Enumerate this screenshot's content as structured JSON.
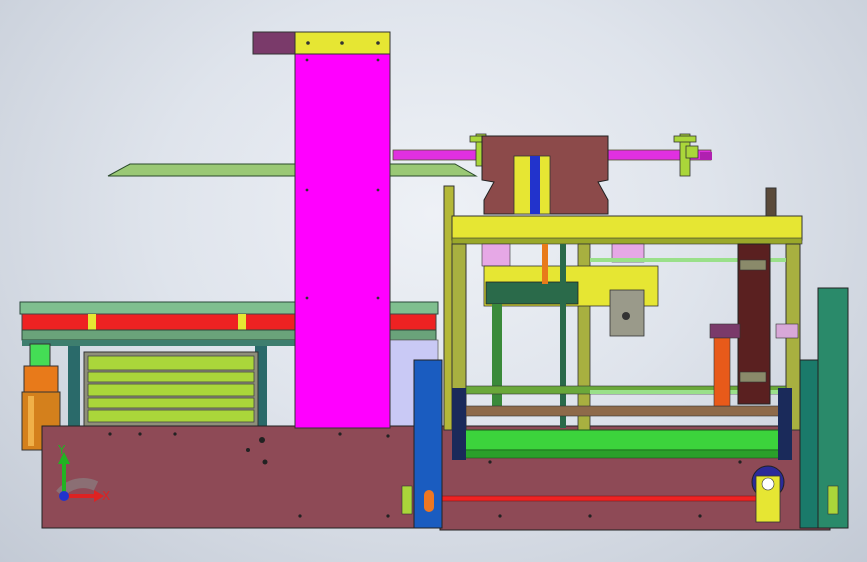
{
  "viewport": {
    "background_colors": [
      "#eef1f6",
      "#dfe4ec",
      "#c3cad5"
    ]
  },
  "triad": {
    "y_label": "Y",
    "x_label": "X",
    "y_color": "#22b322",
    "x_color": "#dd2222",
    "z_color": "#2233cc"
  },
  "colors": {
    "magenta": "#ff00ff",
    "yellow": "#e6e633",
    "olive": "#b4b838",
    "base_brown": "#8e4a56",
    "brown": "#8c4a4a",
    "green": "#3cd33c",
    "red": "#ee2222",
    "blue": "#1a5cc0",
    "teal": "#1a7a6a",
    "orange": "#e87a1a",
    "purple": "#7a3a6a"
  }
}
